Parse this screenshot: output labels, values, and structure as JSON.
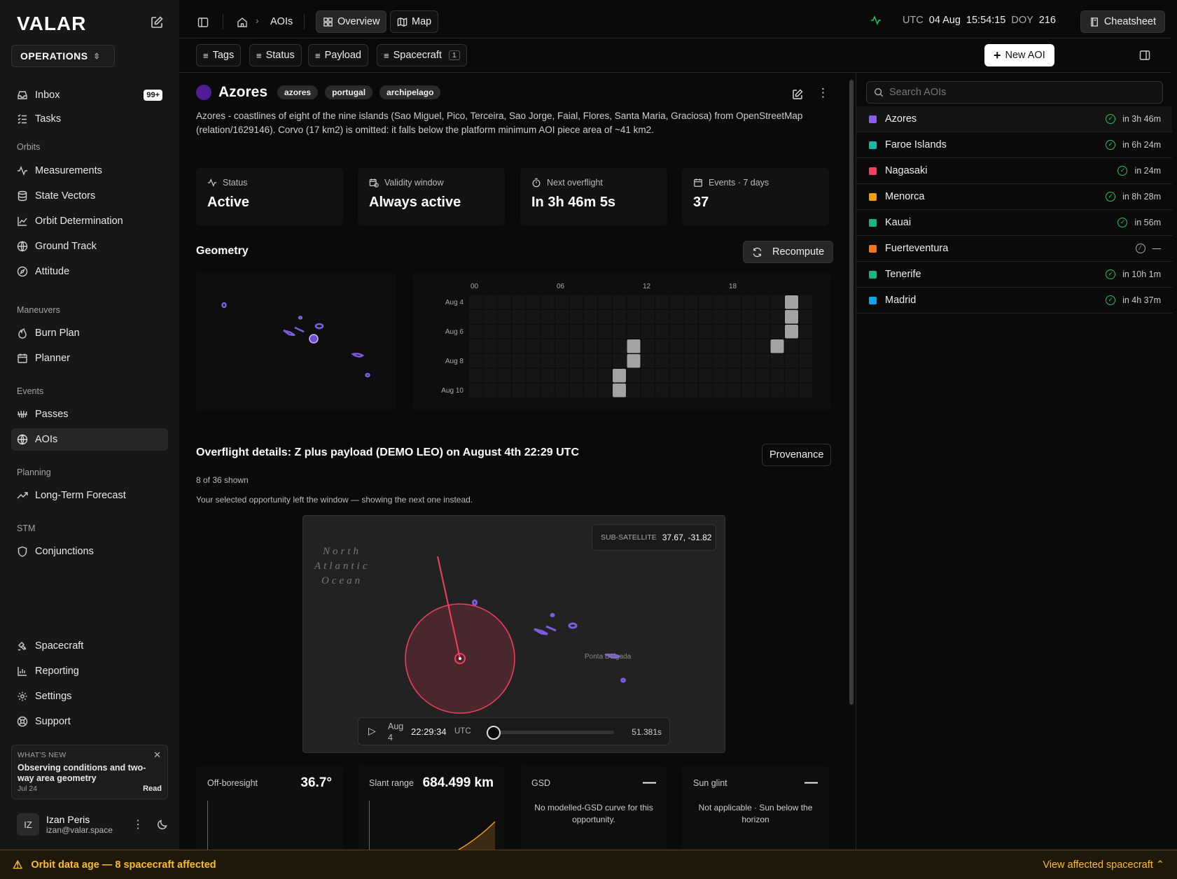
{
  "brand": {
    "logo": "VALAR",
    "workspace": "OPERATIONS"
  },
  "sidebar": {
    "top_items": [
      {
        "label": "Inbox",
        "badge": "99+"
      },
      {
        "label": "Tasks"
      }
    ],
    "sections": {
      "orbits": "Orbits",
      "maneuvers": "Maneuvers",
      "events": "Events",
      "planning": "Planning",
      "stm": "STM"
    },
    "orbits": [
      "Measurements",
      "State Vectors",
      "Orbit Determination",
      "Ground Track",
      "Attitude"
    ],
    "maneuvers": [
      "Burn Plan",
      "Planner"
    ],
    "events": [
      "Passes",
      "AOIs"
    ],
    "planning": [
      "Long-Term Forecast"
    ],
    "stm": [
      "Conjunctions"
    ],
    "bottom": [
      "Spacecraft",
      "Reporting",
      "Settings",
      "Support"
    ]
  },
  "whats_new": {
    "kicker": "WHAT'S NEW",
    "title": "Observing conditions and two-way area geometry",
    "date": "Jul 24",
    "action": "Read"
  },
  "user": {
    "initials": "IZ",
    "name": "Izan Peris",
    "email": "izan@valar.space"
  },
  "topbar": {
    "breadcrumb": "AOIs",
    "tabs": [
      "Overview",
      "Map"
    ],
    "clock": {
      "utc_label": "UTC",
      "date": "04 Aug",
      "time": "15:54:15",
      "doy_label": "DOY",
      "doy": "216"
    },
    "cheatsheet": "Cheatsheet",
    "filters": [
      "Tags",
      "Status",
      "Payload",
      "Spacecraft"
    ],
    "spacecraft_count": "1",
    "new_aoi": "New AOI"
  },
  "aoi": {
    "name": "Azores",
    "tags": [
      "azores",
      "portugal",
      "archipelago"
    ],
    "description": "Azores - coastlines of eight of the nine islands (Sao Miguel, Pico, Terceira, Sao Jorge, Faial, Flores, Santa Maria, Graciosa) from OpenStreetMap (relation/1629146). Corvo (17 km2) is omitted: it falls below the platform minimum AOI piece area of ~41 km2.",
    "stats": [
      {
        "label": "Status",
        "value": "Active"
      },
      {
        "label": "Validity window",
        "value": "Always active"
      },
      {
        "label": "Next overflight",
        "value": "In 3h 46m 5s"
      },
      {
        "label": "Events · 7 days",
        "value": "37"
      }
    ]
  },
  "geometry": {
    "title": "Geometry",
    "recompute": "Recompute",
    "hour_ticks": [
      "00",
      "06",
      "12",
      "18"
    ],
    "day_labels": [
      "Aug 4",
      "Aug 6",
      "Aug 8",
      "Aug 10"
    ],
    "heatmap_cells": [
      {
        "day": 0,
        "hour": 22
      },
      {
        "day": 1,
        "hour": 22
      },
      {
        "day": 2,
        "hour": 22
      },
      {
        "day": 3,
        "hour": 11
      },
      {
        "day": 3,
        "hour": 21
      },
      {
        "day": 4,
        "hour": 11
      },
      {
        "day": 5,
        "hour": 10
      },
      {
        "day": 6,
        "hour": 10
      }
    ]
  },
  "overflight": {
    "title": "Overflight details: Z plus payload (DEMO LEO) on August 4th 22:29 UTC",
    "provenance": "Provenance",
    "shown": "8 of 36 shown",
    "note": "Your selected opportunity left the window — showing the next one instead.",
    "ocean_label": [
      "North",
      "Atlantic",
      "Ocean"
    ],
    "place_label": "Ponta Delgada",
    "subsat_label": "SUB-SATELLITE",
    "subsat_value": "37.67, -31.82",
    "player": {
      "date": "Aug 4",
      "time": "22:29:34",
      "tz": "UTC",
      "duration": "51.381s",
      "progress": 0
    }
  },
  "metrics": [
    {
      "label": "Off-boresight",
      "value": "36.7°"
    },
    {
      "label": "Slant range",
      "value": "684.499 km"
    },
    {
      "label": "GSD",
      "value": "—",
      "note": "No modelled-GSD curve for this opportunity."
    },
    {
      "label": "Sun glint",
      "value": "—",
      "note": "Not applicable · Sun below the horizon"
    }
  ],
  "right_panel": {
    "search_placeholder": "Search AOIs",
    "aois": [
      {
        "name": "Azores",
        "color": "#8b5cf6",
        "eta": "in 3h 46m",
        "status": "ok"
      },
      {
        "name": "Faroe Islands",
        "color": "#14b8a6",
        "eta": "in 6h 24m",
        "status": "ok"
      },
      {
        "name": "Nagasaki",
        "color": "#f43f5e",
        "eta": "in 24m",
        "status": "ok"
      },
      {
        "name": "Menorca",
        "color": "#f59e0b",
        "eta": "in 8h 28m",
        "status": "ok"
      },
      {
        "name": "Kauai",
        "color": "#10b981",
        "eta": "in 56m",
        "status": "ok"
      },
      {
        "name": "Fuerteventura",
        "color": "#f97316",
        "eta": "—",
        "status": "disabled"
      },
      {
        "name": "Tenerife",
        "color": "#10b981",
        "eta": "in 10h 1m",
        "status": "ok"
      },
      {
        "name": "Madrid",
        "color": "#0ea5e9",
        "eta": "in 4h 37m",
        "status": "ok"
      }
    ]
  },
  "banner": {
    "text": "Orbit data age — 8 spacecraft affected",
    "action": "View affected spacecraft"
  }
}
